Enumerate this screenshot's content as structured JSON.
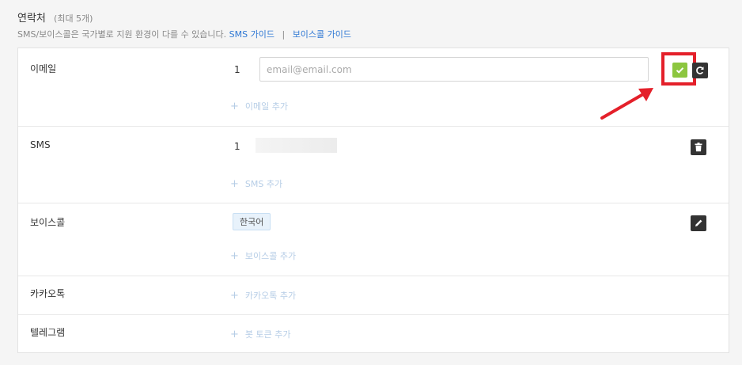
{
  "header": {
    "title": "연락처",
    "max_note": "(최대 5개)",
    "desc": "SMS/보이스콜은 국가별로 지원 환경이 다를 수 있습니다.",
    "sms_guide": "SMS 가이드",
    "separator": "|",
    "voice_guide": "보이스콜 가이드"
  },
  "rows": {
    "email": {
      "label": "이메일",
      "index": "1",
      "placeholder": "email@email.com",
      "add": "이메일 추가"
    },
    "sms": {
      "label": "SMS",
      "index": "1",
      "add": "SMS 추가"
    },
    "voice": {
      "label": "보이스콜",
      "language": "한국어",
      "add": "보이스콜 추가"
    },
    "kakao": {
      "label": "카카오톡",
      "add": "카카오톡 추가"
    },
    "telegram": {
      "label": "텔레그램",
      "add": "봇 토큰 추가"
    }
  },
  "icons": {
    "confirm": "check-icon",
    "reset": "undo-icon",
    "delete": "trash-icon",
    "edit": "pencil-icon",
    "add": "plus-icon"
  },
  "colors": {
    "confirm": "#8cc63f",
    "highlight": "#e4202a",
    "link": "#2f78d4",
    "add_link": "#b6cde6"
  }
}
